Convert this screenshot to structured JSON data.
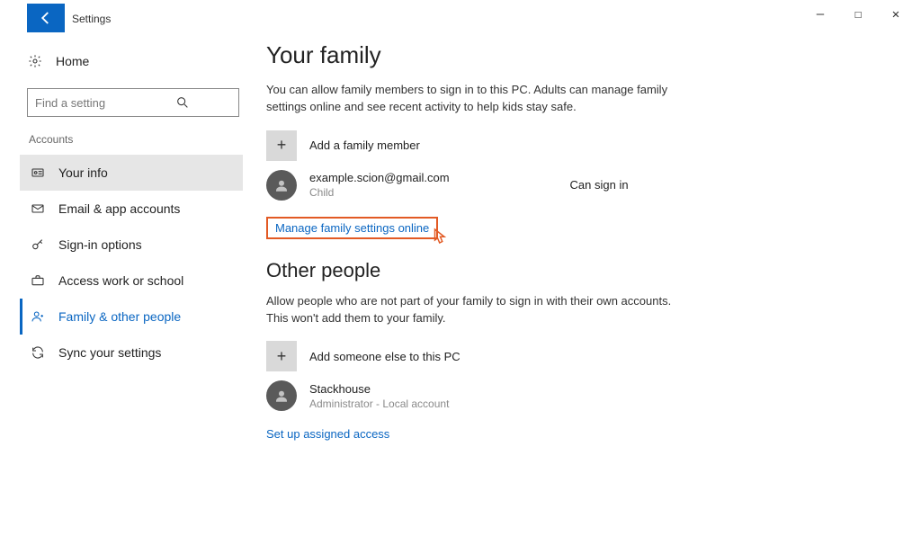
{
  "titlebar": {
    "app_name": "Settings"
  },
  "sidebar": {
    "home": "Home",
    "search_placeholder": "Find a setting",
    "category": "Accounts",
    "items": [
      {
        "icon": "id-card",
        "label": "Your info"
      },
      {
        "icon": "mail",
        "label": "Email & app accounts"
      },
      {
        "icon": "key",
        "label": "Sign-in options"
      },
      {
        "icon": "briefcase",
        "label": "Access work or school"
      },
      {
        "icon": "person",
        "label": "Family & other people"
      },
      {
        "icon": "sync",
        "label": "Sync your settings"
      }
    ]
  },
  "main": {
    "family_heading": "Your family",
    "family_desc": "You can allow family members to sign in to this PC. Adults can manage family settings online and see recent activity to help kids stay safe.",
    "add_family": "Add a family member",
    "family_member": {
      "email": "example.scion@gmail.com",
      "role": "Child",
      "status": "Can sign in"
    },
    "manage_link": "Manage family settings online",
    "other_heading": "Other people",
    "other_desc": "Allow people who are not part of your family to sign in with their own accounts. This won't add them to your family.",
    "add_other": "Add someone else to this PC",
    "other_user": {
      "name": "Stackhouse",
      "role": "Administrator - Local account"
    },
    "assigned_link": "Set up assigned access"
  }
}
